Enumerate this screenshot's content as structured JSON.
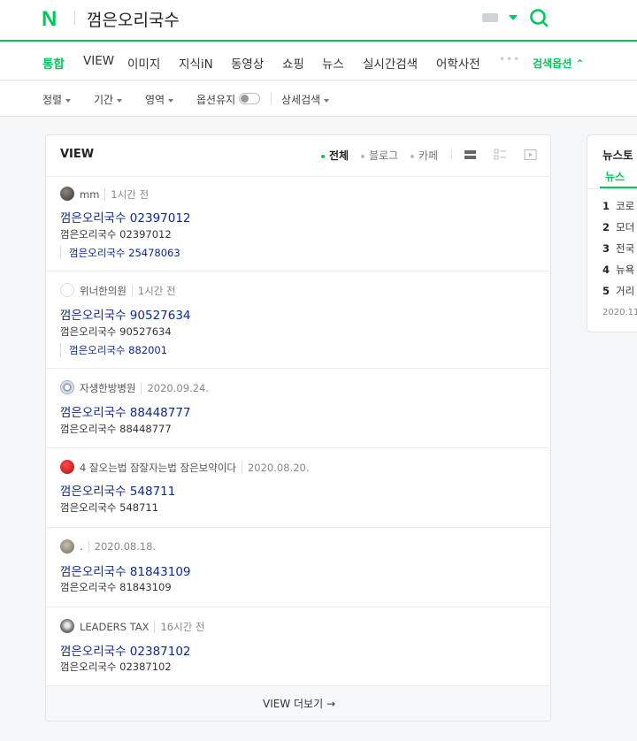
{
  "header": {
    "logo": "N",
    "query": "껌은오리국수"
  },
  "tabs": [
    {
      "label": "통합"
    },
    {
      "label": "VIEW"
    },
    {
      "label": "이미지"
    },
    {
      "label": "지식iN"
    },
    {
      "label": "동영상"
    },
    {
      "label": "쇼핑"
    },
    {
      "label": "뉴스"
    },
    {
      "label": "실시간검색"
    },
    {
      "label": "어학사전"
    }
  ],
  "tabs_more": "•••",
  "tab_options": "검색옵션 ⌃",
  "filters": {
    "sort": "정렬",
    "period": "기간",
    "area": "영역",
    "keep": "옵션유지",
    "detail": "상세검색"
  },
  "view": {
    "title": "VIEW",
    "filter_all": "전체",
    "filter_blog": "블로그",
    "filter_cafe": "카페",
    "items": [
      {
        "author": "mm",
        "time": "1시간 전",
        "title": "껌은오리국수 02397012",
        "desc": "껌은오리국수 02397012",
        "sub": "껌은오리국수 25478063"
      },
      {
        "author": "위너한의원",
        "time": "1시간 전",
        "title": "껌은오리국수 90527634",
        "desc": "껌은오리국수 90527634",
        "sub": "껌은오리국수 882001"
      },
      {
        "author": "자생한방병원",
        "time": "2020.09.24.",
        "title": "껌은오리국수 88448777",
        "desc": "껌은오리국수 88448777"
      },
      {
        "author": "4 잘오는법 잠잘자는법 잠은보약이다",
        "time": "2020.08.20.",
        "title": "껌은오리국수 548711",
        "desc": "껌은오리국수 548711"
      },
      {
        "author": ".",
        "time": "2020.08.18.",
        "title": "껌은오리국수 81843109",
        "desc": "껌은오리국수 81843109"
      },
      {
        "author": "LEADERS TAX",
        "time": "16시간 전",
        "title": "껌은오리국수 02387102",
        "desc": "껌은오리국수 02387102"
      }
    ],
    "more": "VIEW 더보기 →"
  },
  "side": {
    "title": "뉴스토",
    "tab": "뉴스",
    "rows": [
      {
        "num": "1",
        "text": "코로"
      },
      {
        "num": "2",
        "text": "모더"
      },
      {
        "num": "3",
        "text": "전국"
      },
      {
        "num": "4",
        "text": "뉴욕"
      },
      {
        "num": "5",
        "text": "거리"
      }
    ],
    "date": "2020.11."
  },
  "colors": {
    "brand": "#03c75a",
    "link": "#0c2a90"
  }
}
